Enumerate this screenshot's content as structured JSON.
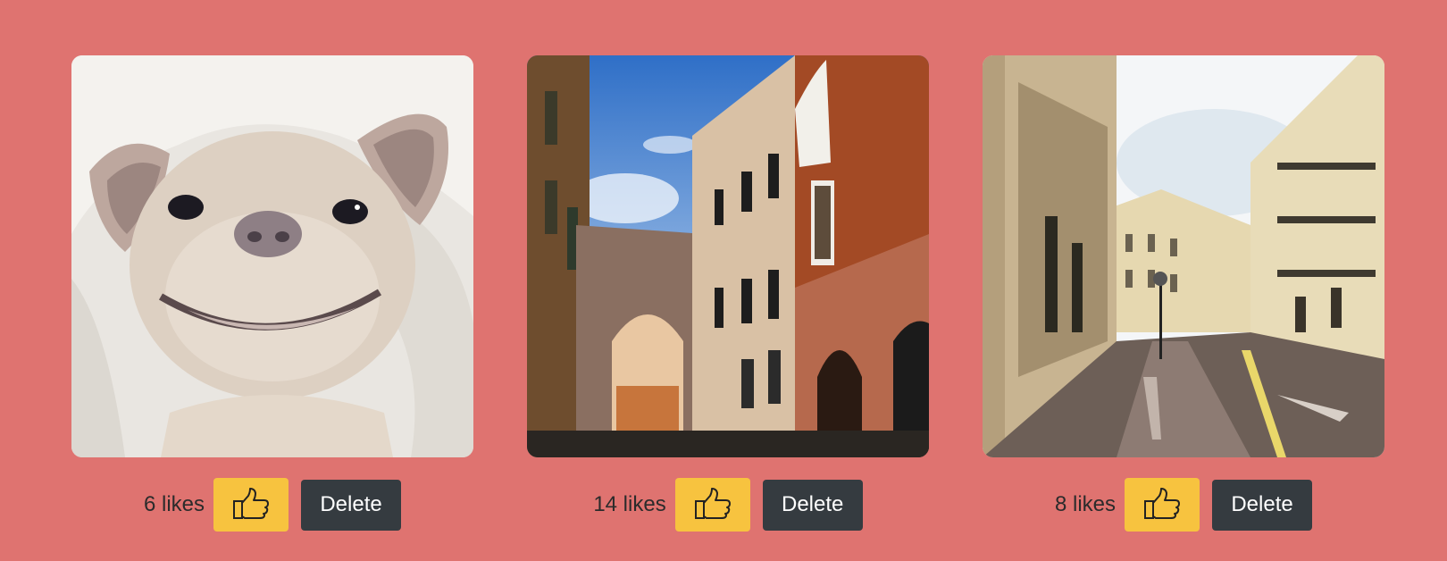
{
  "posts": [
    {
      "likes_text": "6 likes",
      "like_icon": "thumbs-up-icon",
      "delete_label": "Delete",
      "image_subject": "french-bulldog-photo"
    },
    {
      "likes_text": "14 likes",
      "like_icon": "thumbs-up-icon",
      "delete_label": "Delete",
      "image_subject": "rome-street-arch-photo"
    },
    {
      "likes_text": "8 likes",
      "like_icon": "thumbs-up-icon",
      "delete_label": "Delete",
      "image_subject": "paris-street-photo"
    }
  ],
  "colors": {
    "background": "#df7370",
    "like_button": "#f7c33f",
    "delete_button": "#353b40",
    "delete_text": "#ffffff",
    "likes_text": "#2b2b2b"
  }
}
